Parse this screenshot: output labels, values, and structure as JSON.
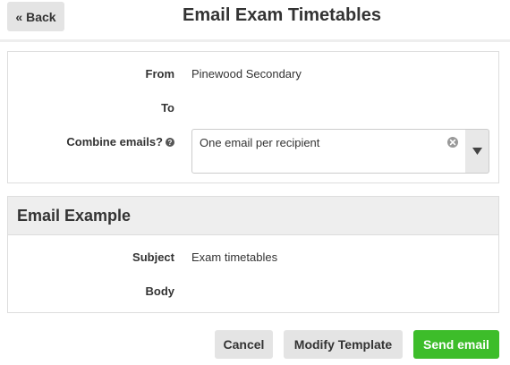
{
  "header": {
    "back_label": "« Back",
    "title": "Email Exam Timetables"
  },
  "form": {
    "from_label": "From",
    "from_value": "Pinewood Secondary",
    "to_label": "To",
    "to_value": "",
    "combine_label": "Combine emails?",
    "combine_selected": "One email per recipient",
    "help_icon": "question-circle-icon",
    "clear_icon": "clear-circle-icon",
    "dropdown_icon": "caret-down-icon"
  },
  "email_example": {
    "title": "Email Example",
    "subject_label": "Subject",
    "subject_value": "Exam timetables",
    "body_label": "Body",
    "body_value": ""
  },
  "actions": {
    "cancel_label": "Cancel",
    "modify_label": "Modify Template",
    "send_label": "Send email"
  },
  "colors": {
    "send_button": "#3dbd2a",
    "neutral_button": "#e4e4e4",
    "panel_header": "#eeeeee",
    "border": "#dddddd",
    "text": "#333333"
  }
}
